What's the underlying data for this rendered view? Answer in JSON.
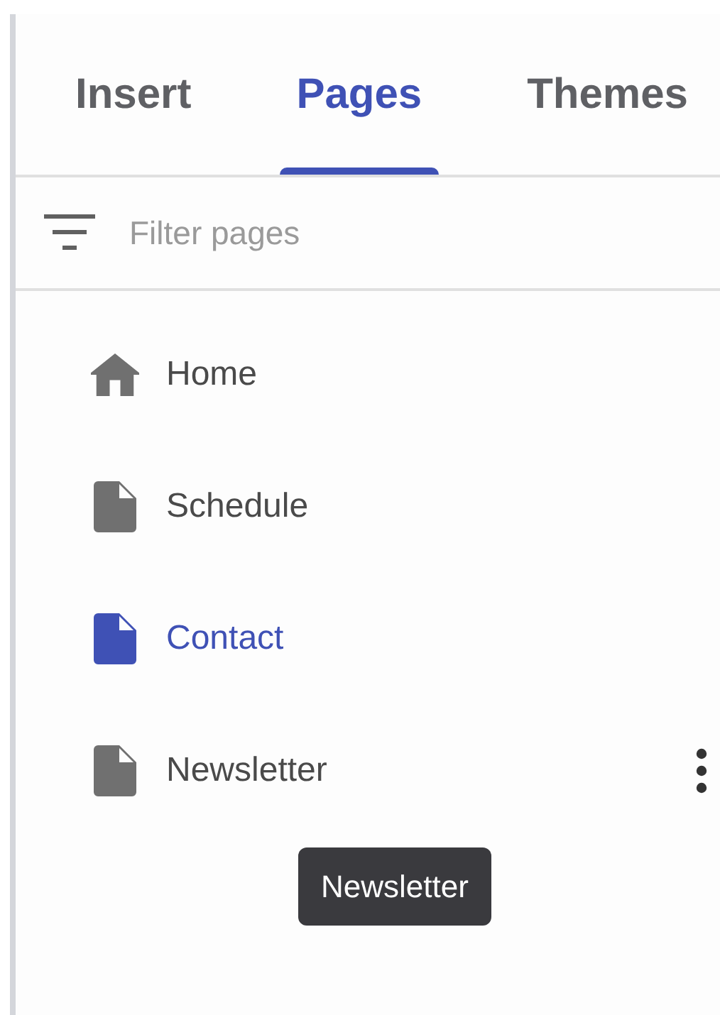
{
  "tabs": [
    {
      "label": "Insert",
      "selected": false
    },
    {
      "label": "Pages",
      "selected": true
    },
    {
      "label": "Themes",
      "selected": false
    }
  ],
  "filter": {
    "placeholder": "Filter pages"
  },
  "pages": [
    {
      "kind": "home",
      "label": "Home",
      "selected": false,
      "hovered": false
    },
    {
      "kind": "page",
      "label": "Schedule",
      "selected": false,
      "hovered": false
    },
    {
      "kind": "page",
      "label": "Contact",
      "selected": true,
      "hovered": false
    },
    {
      "kind": "page",
      "label": "Newsletter",
      "selected": false,
      "hovered": true
    }
  ],
  "tooltip": "Newsletter"
}
